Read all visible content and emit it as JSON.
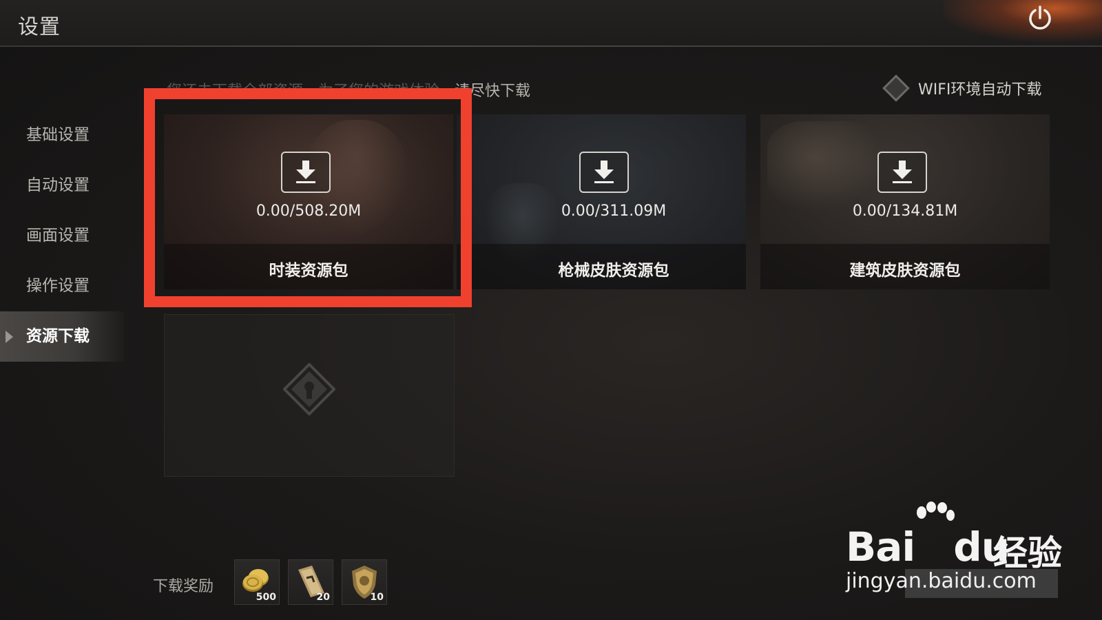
{
  "header": {
    "title": "设置"
  },
  "sidebar": {
    "items": [
      {
        "label": "基础设置",
        "active": false
      },
      {
        "label": "自动设置",
        "active": false
      },
      {
        "label": "画面设置",
        "active": false
      },
      {
        "label": "操作设置",
        "active": false
      },
      {
        "label": "资源下载",
        "active": true
      }
    ]
  },
  "notice": {
    "text_faded": "您还未下载全部资源，为了您的游戏体验，",
    "text": "请尽快下载"
  },
  "wifi_toggle": {
    "label": "WIFI环境自动下载",
    "checked": false
  },
  "packages": [
    {
      "name": "时装资源包",
      "progress": "0.00/508.20M",
      "icon": "download-icon"
    },
    {
      "name": "枪械皮肤资源包",
      "progress": "0.00/311.09M",
      "icon": "download-icon"
    },
    {
      "name": "建筑皮肤资源包",
      "progress": "0.00/134.81M",
      "icon": "download-icon"
    }
  ],
  "locked_slot": {
    "icon": "lock-icon"
  },
  "rewards": {
    "label": "下载奖励",
    "items": [
      {
        "icon": "coin-icon",
        "qty": "500"
      },
      {
        "icon": "ticket-icon",
        "qty": "20"
      },
      {
        "icon": "shield-badge-icon",
        "qty": "10"
      }
    ]
  },
  "watermark": {
    "brand": "Bai",
    "brand_du": "du",
    "cn": "经验",
    "url": "jingyan.baidu.com"
  },
  "colors": {
    "highlight": "#f0412f",
    "background": "#1c1a19",
    "ember": "#d75f28"
  }
}
